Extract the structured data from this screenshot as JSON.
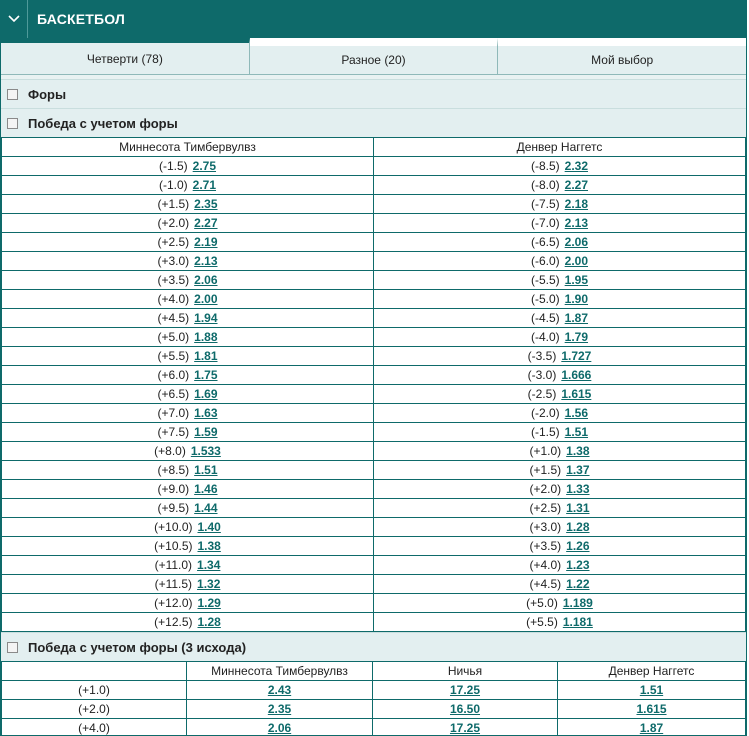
{
  "header": {
    "title": "БАСКЕТБОЛ"
  },
  "tabs": [
    {
      "label": "Четверти (78)"
    },
    {
      "label": "Разное (20)"
    },
    {
      "label": "Мой выбор"
    }
  ],
  "sections": {
    "fory": "Форы",
    "handicap": "Победа с учетом форы",
    "handicap3": "Победа с учетом форы (3 исхода)"
  },
  "handicap_table": {
    "headers": [
      "Миннесота Тимбервулвз",
      "Денвер Наггетс"
    ],
    "rows": [
      {
        "h1": "(-1.5)",
        "o1": "2.75",
        "h2": "(-8.5)",
        "o2": "2.32"
      },
      {
        "h1": "(-1.0)",
        "o1": "2.71",
        "h2": "(-8.0)",
        "o2": "2.27"
      },
      {
        "h1": "(+1.5)",
        "o1": "2.35",
        "h2": "(-7.5)",
        "o2": "2.18"
      },
      {
        "h1": "(+2.0)",
        "o1": "2.27",
        "h2": "(-7.0)",
        "o2": "2.13"
      },
      {
        "h1": "(+2.5)",
        "o1": "2.19",
        "h2": "(-6.5)",
        "o2": "2.06"
      },
      {
        "h1": "(+3.0)",
        "o1": "2.13",
        "h2": "(-6.0)",
        "o2": "2.00"
      },
      {
        "h1": "(+3.5)",
        "o1": "2.06",
        "h2": "(-5.5)",
        "o2": "1.95"
      },
      {
        "h1": "(+4.0)",
        "o1": "2.00",
        "h2": "(-5.0)",
        "o2": "1.90"
      },
      {
        "h1": "(+4.5)",
        "o1": "1.94",
        "h2": "(-4.5)",
        "o2": "1.87"
      },
      {
        "h1": "(+5.0)",
        "o1": "1.88",
        "h2": "(-4.0)",
        "o2": "1.79"
      },
      {
        "h1": "(+5.5)",
        "o1": "1.81",
        "h2": "(-3.5)",
        "o2": "1.727"
      },
      {
        "h1": "(+6.0)",
        "o1": "1.75",
        "h2": "(-3.0)",
        "o2": "1.666"
      },
      {
        "h1": "(+6.5)",
        "o1": "1.69",
        "h2": "(-2.5)",
        "o2": "1.615"
      },
      {
        "h1": "(+7.0)",
        "o1": "1.63",
        "h2": "(-2.0)",
        "o2": "1.56"
      },
      {
        "h1": "(+7.5)",
        "o1": "1.59",
        "h2": "(-1.5)",
        "o2": "1.51"
      },
      {
        "h1": "(+8.0)",
        "o1": "1.533",
        "h2": "(+1.0)",
        "o2": "1.38"
      },
      {
        "h1": "(+8.5)",
        "o1": "1.51",
        "h2": "(+1.5)",
        "o2": "1.37"
      },
      {
        "h1": "(+9.0)",
        "o1": "1.46",
        "h2": "(+2.0)",
        "o2": "1.33"
      },
      {
        "h1": "(+9.5)",
        "o1": "1.44",
        "h2": "(+2.5)",
        "o2": "1.31"
      },
      {
        "h1": "(+10.0)",
        "o1": "1.40",
        "h2": "(+3.0)",
        "o2": "1.28"
      },
      {
        "h1": "(+10.5)",
        "o1": "1.38",
        "h2": "(+3.5)",
        "o2": "1.26"
      },
      {
        "h1": "(+11.0)",
        "o1": "1.34",
        "h2": "(+4.0)",
        "o2": "1.23"
      },
      {
        "h1": "(+11.5)",
        "o1": "1.32",
        "h2": "(+4.5)",
        "o2": "1.22"
      },
      {
        "h1": "(+12.0)",
        "o1": "1.29",
        "h2": "(+5.0)",
        "o2": "1.189"
      },
      {
        "h1": "(+12.5)",
        "o1": "1.28",
        "h2": "(+5.5)",
        "o2": "1.181"
      }
    ]
  },
  "handicap3_table": {
    "headers": [
      "",
      "Миннесота Тимбервулвз",
      "Ничья",
      "Денвер Наггетс"
    ],
    "rows": [
      {
        "h": "(+1.0)",
        "o1": "2.43",
        "ox": "17.25",
        "o2": "1.51"
      },
      {
        "h": "(+2.0)",
        "o1": "2.35",
        "ox": "16.50",
        "o2": "1.615"
      },
      {
        "h": "(+4.0)",
        "o1": "2.06",
        "ox": "17.25",
        "o2": "1.87"
      }
    ]
  }
}
